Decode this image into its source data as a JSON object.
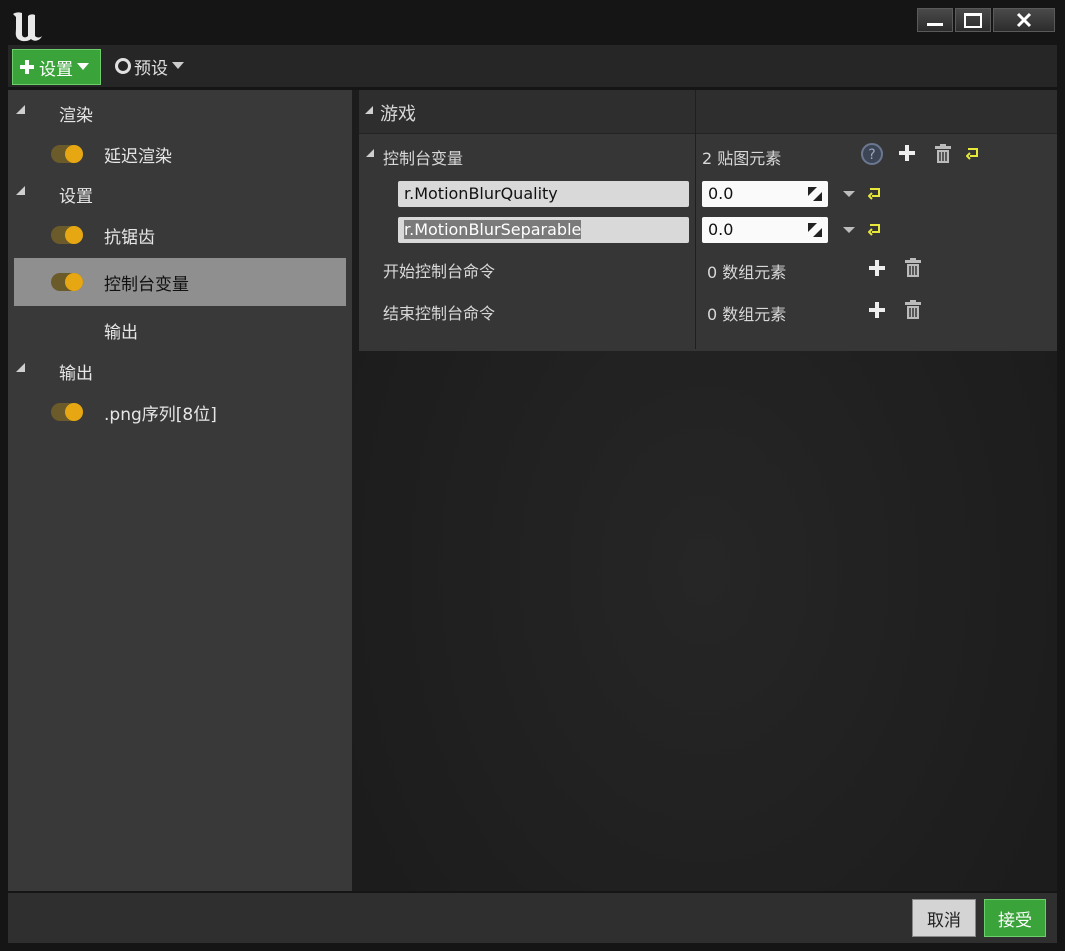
{
  "titlebar": {
    "logo_icon": "unreal-logo-icon",
    "controls": [
      "minimize-icon",
      "maximize-icon",
      "close-icon"
    ]
  },
  "toolbar": {
    "settings_label": "设置",
    "presets_label": "预设"
  },
  "sidebar": {
    "items": [
      {
        "label": "渲染",
        "kind": "category"
      },
      {
        "label": "延迟渲染",
        "kind": "setting",
        "enabled": true
      },
      {
        "label": "设置",
        "kind": "category"
      },
      {
        "label": "抗锯齿",
        "kind": "setting",
        "enabled": true
      },
      {
        "label": "控制台变量",
        "kind": "setting",
        "enabled": true,
        "selected": true
      },
      {
        "label": "输出",
        "kind": "setting"
      },
      {
        "label": "输出",
        "kind": "category"
      },
      {
        "label": ".png序列[8位]",
        "kind": "setting",
        "enabled": true
      }
    ]
  },
  "details": {
    "section_title": "游戏",
    "console_vars": {
      "label": "控制台变量",
      "count_text": "2 贴图元素",
      "rows": [
        {
          "key": "r.MotionBlurQuality",
          "value": "0.0"
        },
        {
          "key": "r.MotionBlurSeparable",
          "value": "0.0"
        }
      ]
    },
    "start_commands": {
      "label": "开始控制台命令",
      "count_text": "0 数组元素"
    },
    "end_commands": {
      "label": "结束控制台命令",
      "count_text": "0 数组元素"
    }
  },
  "footer": {
    "cancel_label": "取消",
    "accept_label": "接受"
  },
  "colors": {
    "accent_green": "#3aa33a",
    "toggle_knob": "#e6a712",
    "reset_yellow": "#e8e83a"
  }
}
